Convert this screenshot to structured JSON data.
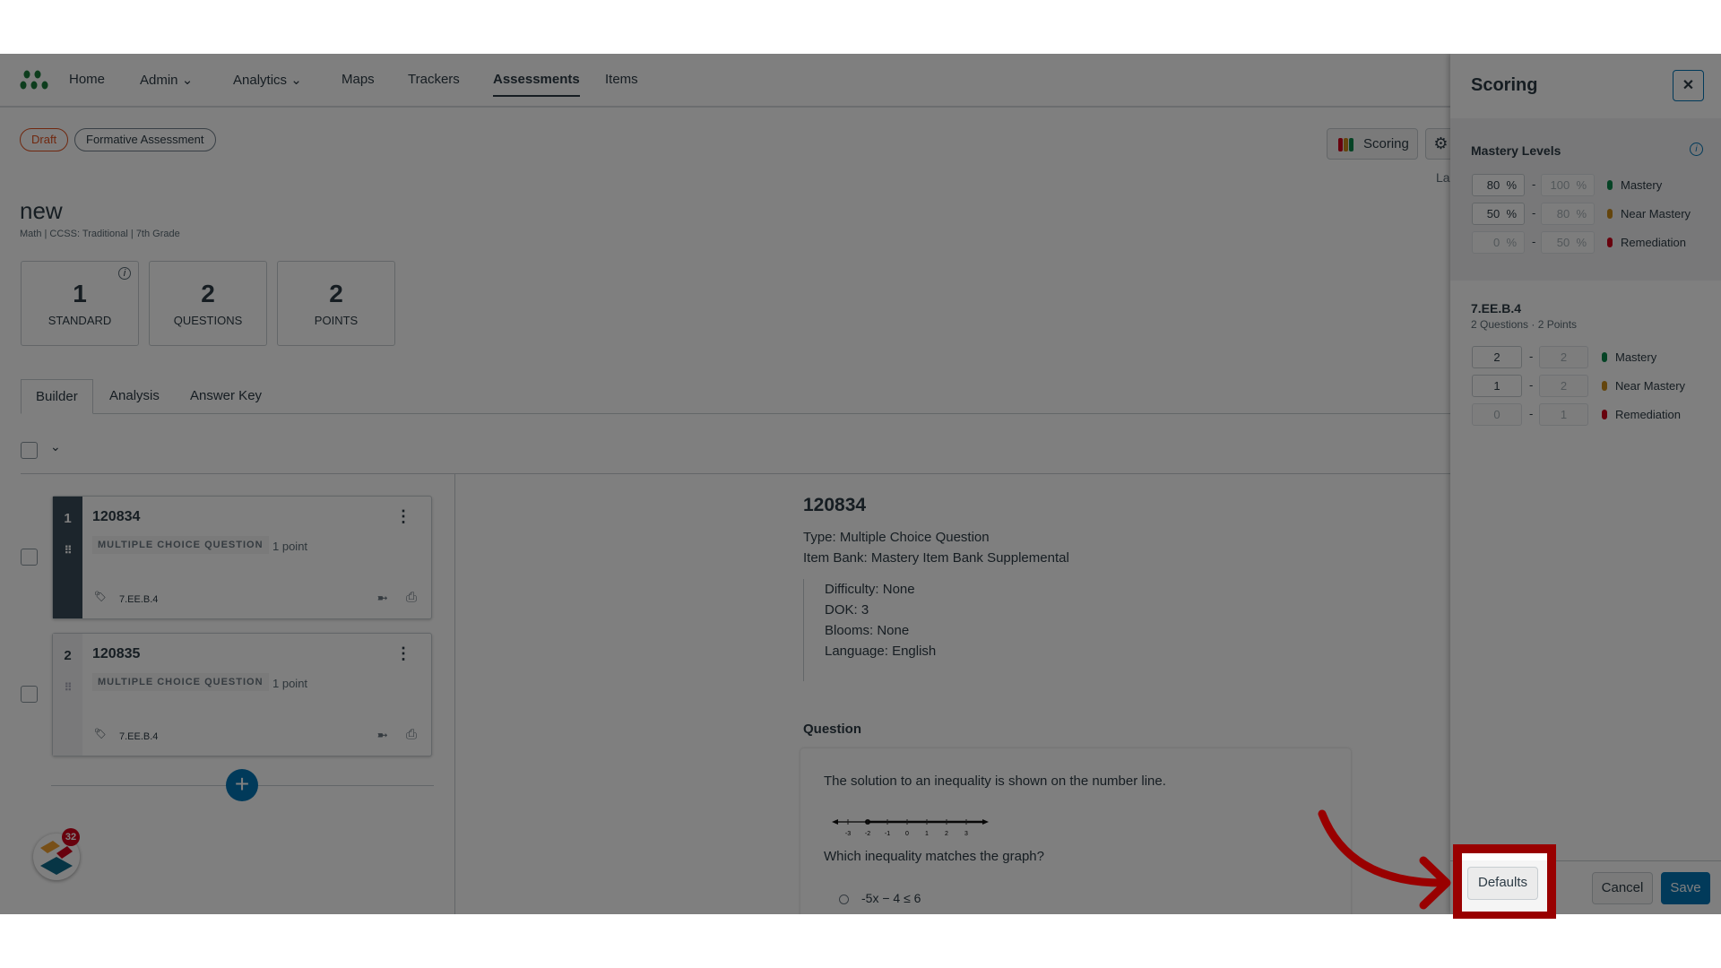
{
  "nav": {
    "items": [
      {
        "label": "Home"
      },
      {
        "label": "Admin"
      },
      {
        "label": "Analytics"
      },
      {
        "label": "Maps"
      },
      {
        "label": "Trackers"
      },
      {
        "label": "Assessments"
      },
      {
        "label": "Items"
      }
    ]
  },
  "badges": {
    "status": "Draft",
    "type": "Formative Assessment"
  },
  "assessment": {
    "title": "new",
    "subtitle": "Math | CCSS: Traditional | 7th Grade"
  },
  "stats": [
    {
      "value": "1",
      "label": "STANDARD"
    },
    {
      "value": "2",
      "label": "QUESTIONS"
    },
    {
      "value": "2",
      "label": "POINTS"
    }
  ],
  "tabs": [
    {
      "label": "Builder"
    },
    {
      "label": "Analysis"
    },
    {
      "label": "Answer Key"
    }
  ],
  "toolbar": {
    "scoring_label": "Scoring",
    "truncated_label": "La"
  },
  "questions": [
    {
      "number": "1",
      "id": "120834",
      "type": "MULTIPLE CHOICE QUESTION",
      "points": "1 point",
      "standard": "7.EE.B.4"
    },
    {
      "number": "2",
      "id": "120835",
      "type": "MULTIPLE CHOICE QUESTION",
      "points": "1 point",
      "standard": "7.EE.B.4"
    }
  ],
  "notification_count": "32",
  "detail": {
    "id": "120834",
    "type": "Type: Multiple Choice Question",
    "item_bank": "Item Bank: Mastery Item Bank Supplemental",
    "difficulty": "Difficulty: None",
    "dok": "DOK: 3",
    "blooms": "Blooms: None",
    "language": "Language: English",
    "question_heading": "Question",
    "prompt": "The solution to an inequality is shown on the number line.",
    "number_line_ticks": [
      "-3",
      "-2",
      "-1",
      "0",
      "1",
      "2",
      "3"
    ],
    "ask": "Which inequality matches the graph?",
    "option1": "-5x − 4 ≤ 6"
  },
  "scoring": {
    "title": "Scoring",
    "mastery_heading": "Mastery Levels",
    "levels": [
      {
        "from": "80",
        "to": "100",
        "unit": "%",
        "label": "Mastery",
        "color": "#0b874b"
      },
      {
        "from": "50",
        "to": "80",
        "unit": "%",
        "label": "Near Mastery",
        "color": "#c88a1a"
      },
      {
        "from": "0",
        "to": "50",
        "unit": "%",
        "label": "Remediation",
        "color": "#d0021b"
      }
    ],
    "standard": {
      "code": "7.EE.B.4",
      "summary": "2 Questions · 2 Points",
      "levels": [
        {
          "from": "2",
          "to": "2",
          "label": "Mastery"
        },
        {
          "from": "1",
          "to": "2",
          "label": "Near Mastery"
        },
        {
          "from": "0",
          "to": "1",
          "label": "Remediation"
        }
      ]
    },
    "defaults_label": "Defaults",
    "cancel_label": "Cancel",
    "save_label": "Save"
  },
  "colors": {
    "accent": "#0374b5",
    "highlight": "#990000"
  }
}
